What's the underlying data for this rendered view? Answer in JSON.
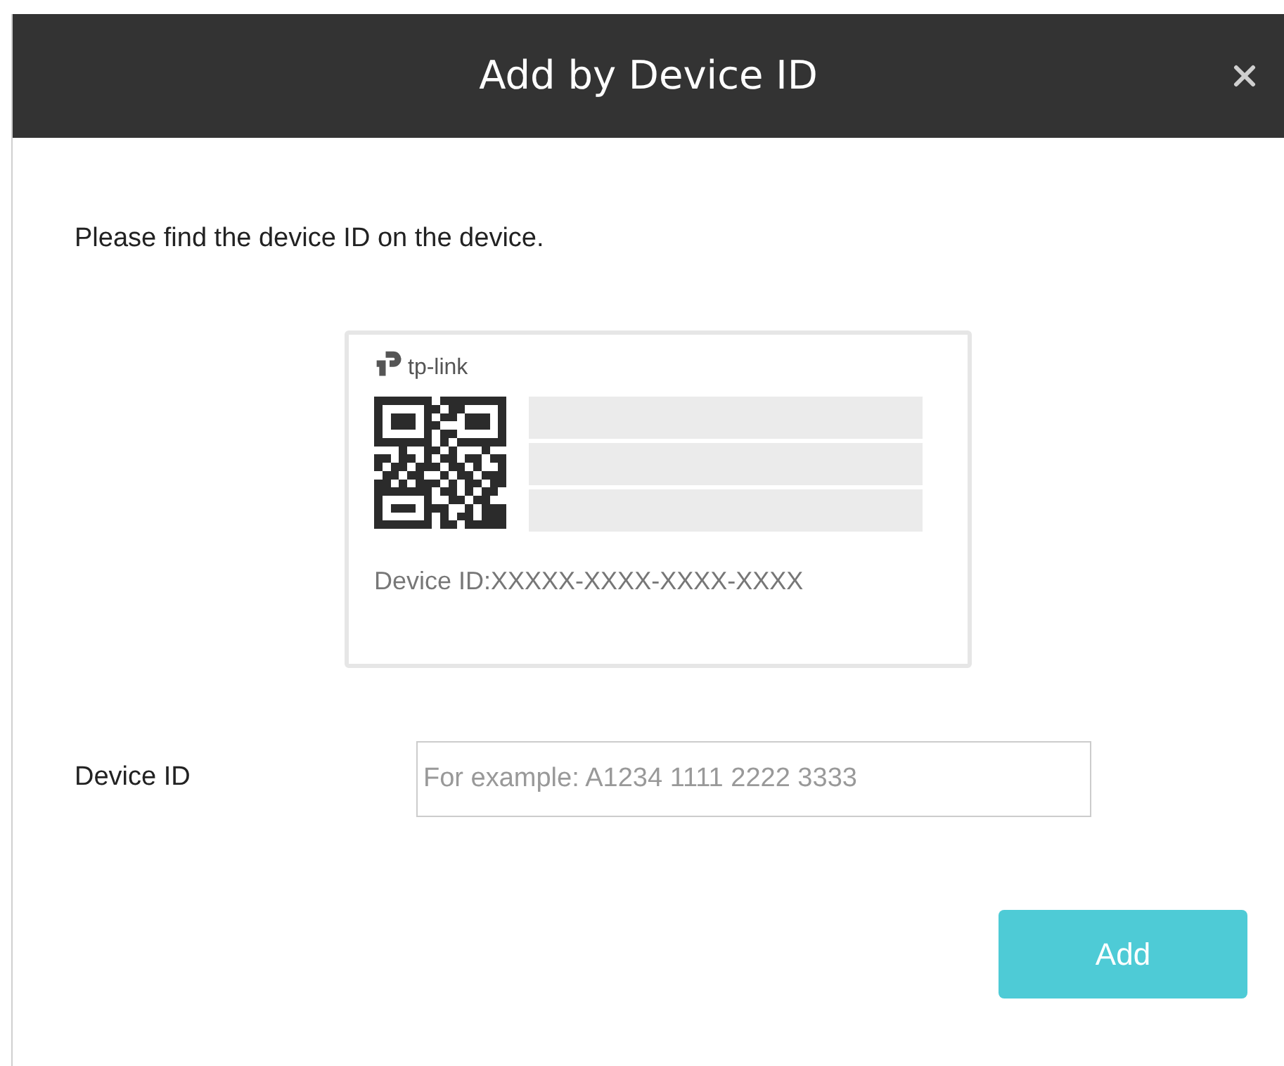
{
  "dialog": {
    "title": "Add by Device ID"
  },
  "instruction": "Please find the device ID on the device.",
  "label_card": {
    "brand": "tp-link",
    "device_id_text": "Device ID:XXXXX-XXXX-XXXX-XXXX"
  },
  "device_id_field": {
    "label": "Device ID",
    "placeholder": "For example: A1234 1111 2222 3333"
  },
  "buttons": [
    {
      "label": "Add",
      "kind": "primary"
    }
  ]
}
